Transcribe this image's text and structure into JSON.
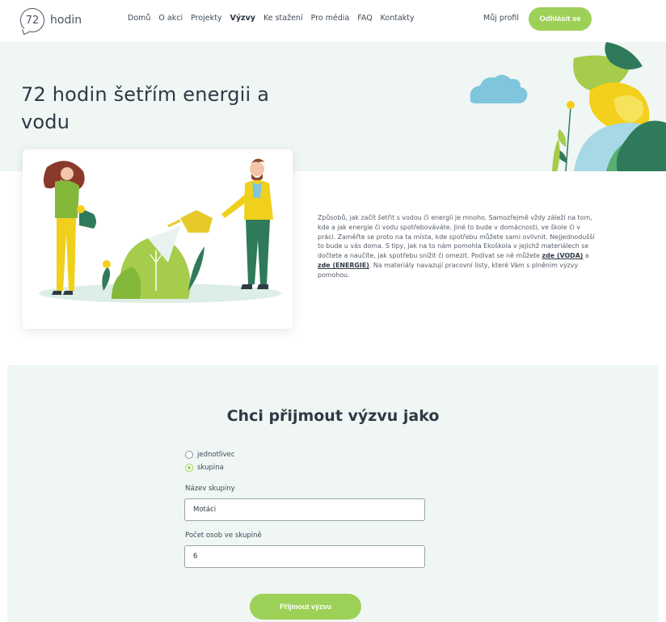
{
  "header": {
    "logo_number": "72",
    "logo_text": "hodin",
    "nav": [
      "Domů",
      "O akci",
      "Projekty",
      "Výzvy",
      "Ke stažení",
      "Pro média",
      "FAQ",
      "Kontakty"
    ],
    "profile_label": "Můj profil",
    "logout_label": "Odhlásit se"
  },
  "hero": {
    "title": "72 hodin šetřím energii a vodu"
  },
  "description": {
    "text_before": "Způsobů, jak začít šetřit s vodou či energií je mnoho. Samozřejmě vždy záleží na tom, kde a jak energie či vodu spotřebováváte. Jiné to bude v domácnosti, ve škole či v práci. Zaměřte se proto na ta místa, kde spotřebu můžete sami ovlivnit. Nejjednodušší to bude u vás doma. S tipy, jak na to nám pomohla Ekoškola v jejichž materiálech se dočtete a naučíte, jak spotřebu snížit či omezit. Podívat se ně můžete ",
    "link_water": "zde (VODA)",
    "text_and": " a ",
    "link_energy": "zde (ENERGIE)",
    "text_after": ". Na materiály navazují pracovní listy, které Vám s plněním výzvy pomohou."
  },
  "form": {
    "title": "Chci přijmout výzvu jako",
    "option_individual": "jednotlivec",
    "option_group": "skupina",
    "selected": "skupina",
    "group_name_label": "Název skupiny",
    "group_name_value": "Motáci",
    "group_size_label": "Počet osob ve skupině",
    "group_size_value": "6",
    "submit_label": "Přijmout výzvu"
  },
  "colors": {
    "accent": "#9dd057",
    "section_bg": "#eff6f4",
    "text": "#2f3a45"
  }
}
